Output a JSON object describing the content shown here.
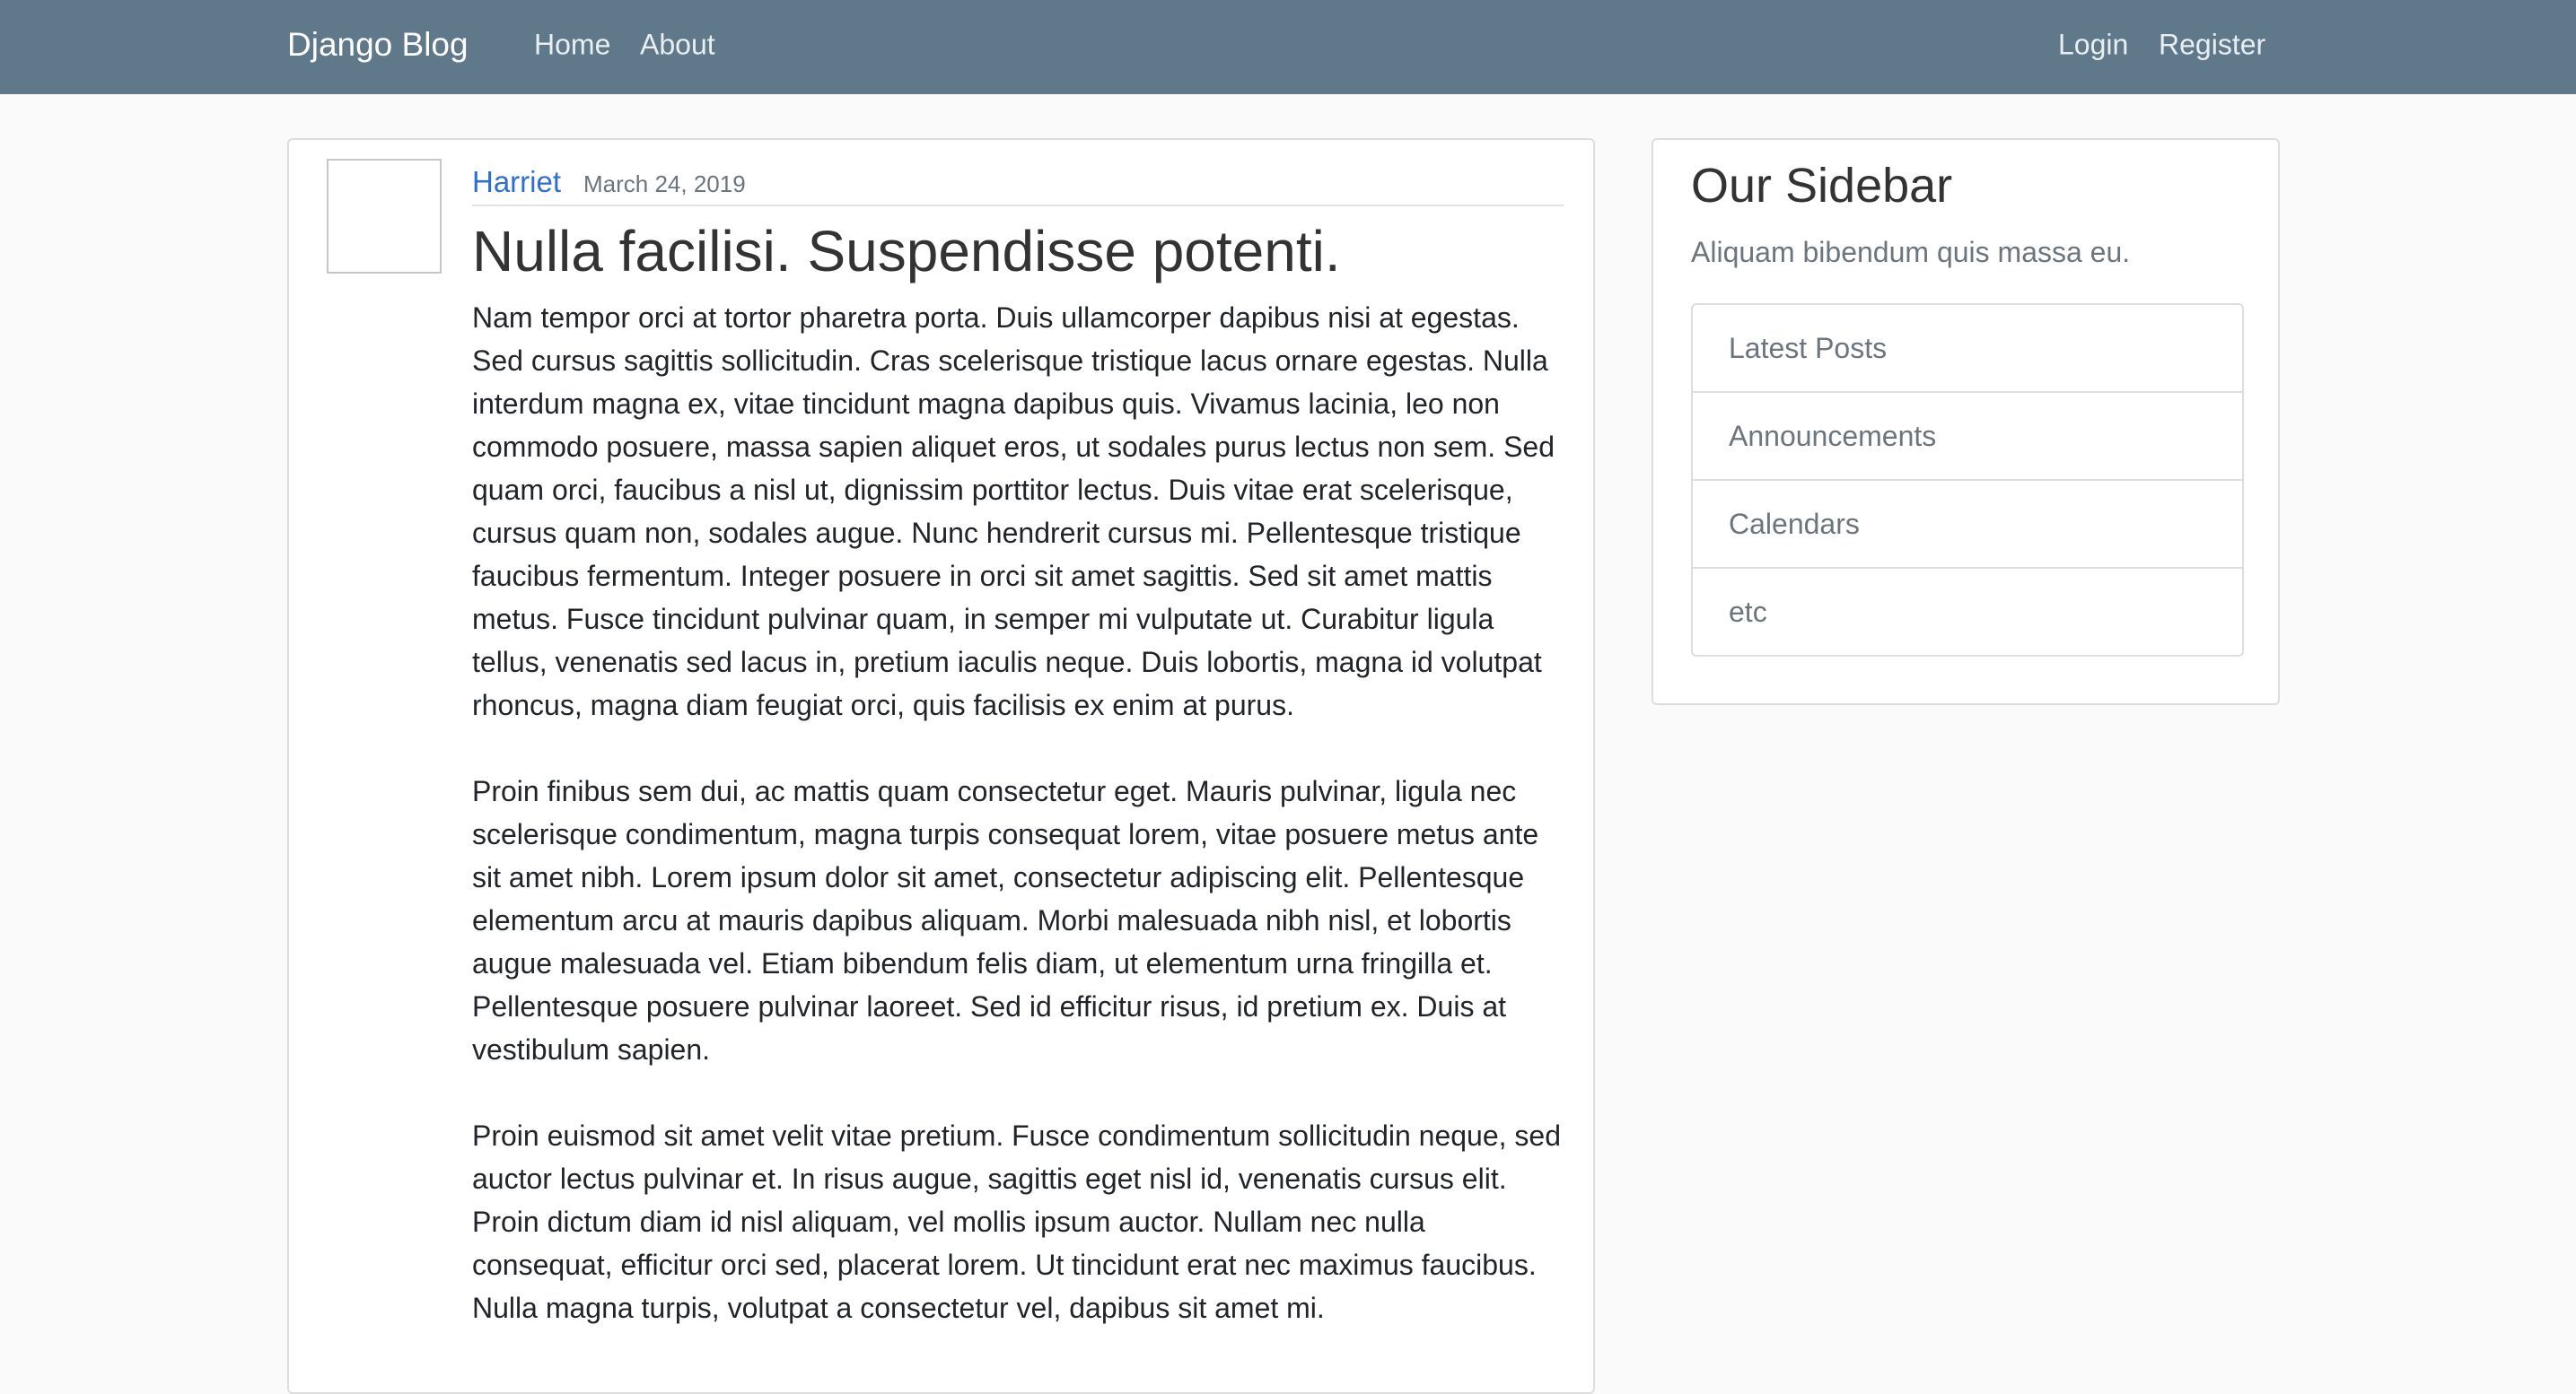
{
  "navbar": {
    "brand": "Django Blog",
    "left_links": [
      "Home",
      "About"
    ],
    "right_links": [
      "Login",
      "Register"
    ],
    "background": "#5f788a"
  },
  "post": {
    "author": "Harriet",
    "date": "March 24, 2019",
    "title": "Nulla facilisi. Suspendisse potenti.",
    "paragraphs": [
      "Nam tempor orci at tortor pharetra porta. Duis ullamcorper dapibus nisi at egestas. Sed cursus sagittis sollicitudin. Cras scelerisque tristique lacus ornare egestas. Nulla interdum magna ex, vitae tincidunt magna dapibus quis. Vivamus lacinia, leo non commodo posuere, massa sapien aliquet eros, ut sodales purus lectus non sem. Sed quam orci, faucibus a nisl ut, dignissim porttitor lectus. Duis vitae erat scelerisque, cursus quam non, sodales augue. Nunc hendrerit cursus mi. Pellentesque tristique faucibus fermentum. Integer posuere in orci sit amet sagittis. Sed sit amet mattis metus. Fusce tincidunt pulvinar quam, in semper mi vulputate ut. Curabitur ligula tellus, venenatis sed lacus in, pretium iaculis neque. Duis lobortis, magna id volutpat rhoncus, magna diam feugiat orci, quis facilisis ex enim at purus.",
      "Proin finibus sem dui, ac mattis quam consectetur eget. Mauris pulvinar, ligula nec scelerisque condimentum, magna turpis consequat lorem, vitae posuere metus ante sit amet nibh. Lorem ipsum dolor sit amet, consectetur adipiscing elit. Pellentesque elementum arcu at mauris dapibus aliquam. Morbi malesuada nibh nisl, et lobortis augue malesuada vel. Etiam bibendum felis diam, ut elementum urna fringilla et. Pellentesque posuere pulvinar laoreet. Sed id efficitur risus, id pretium ex. Duis at vestibulum sapien.",
      "Proin euismod sit amet velit vitae pretium. Fusce condimentum sollicitudin neque, sed auctor lectus pulvinar et. In risus augue, sagittis eget nisl id, venenatis cursus elit. Proin dictum diam id nisl aliquam, vel mollis ipsum auctor. Nullam nec nulla consequat, efficitur orci sed, placerat lorem. Ut tincidunt erat nec maximus faucibus. Nulla magna turpis, volutpat a consectetur vel, dapibus sit amet mi."
    ],
    "author_color": "#2f6fd1"
  },
  "sidebar": {
    "title": "Our Sidebar",
    "description": "Aliquam bibendum quis massa eu.",
    "items": [
      "Latest Posts",
      "Announcements",
      "Calendars",
      "etc"
    ]
  }
}
